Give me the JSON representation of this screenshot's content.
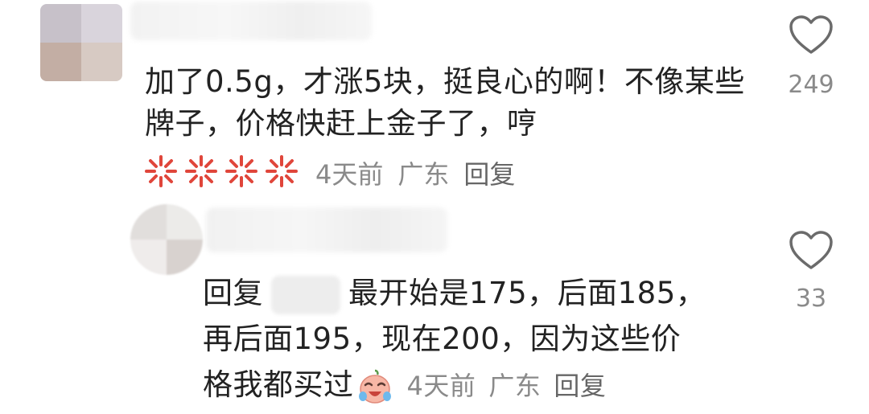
{
  "comments": [
    {
      "text": "加了0.5g，才涨5块，挺良心的啊！不像某些牌子，价格快赶上金子了，哼",
      "reaction_icons": [
        "angry-face-icon",
        "angry-face-icon",
        "angry-face-icon",
        "angry-face-icon"
      ],
      "time": "4天前",
      "location": "广东",
      "reply_label": "回复",
      "likes": "249"
    },
    {
      "reply_prefix": "回复",
      "text_line1": "最开始是175，后面185，",
      "text_line2": "再后面195，现在200，因为这些价",
      "text_line3": "格我都买过",
      "reaction_icon": "crying-laughing-icon",
      "time": "4天前",
      "location": "广东",
      "reply_label": "回复",
      "likes": "33"
    }
  ],
  "colors": {
    "text": "#222222",
    "meta": "#8a8a8a",
    "icon_outline": "#6b6b6b",
    "angry_red": "#e0463b"
  }
}
